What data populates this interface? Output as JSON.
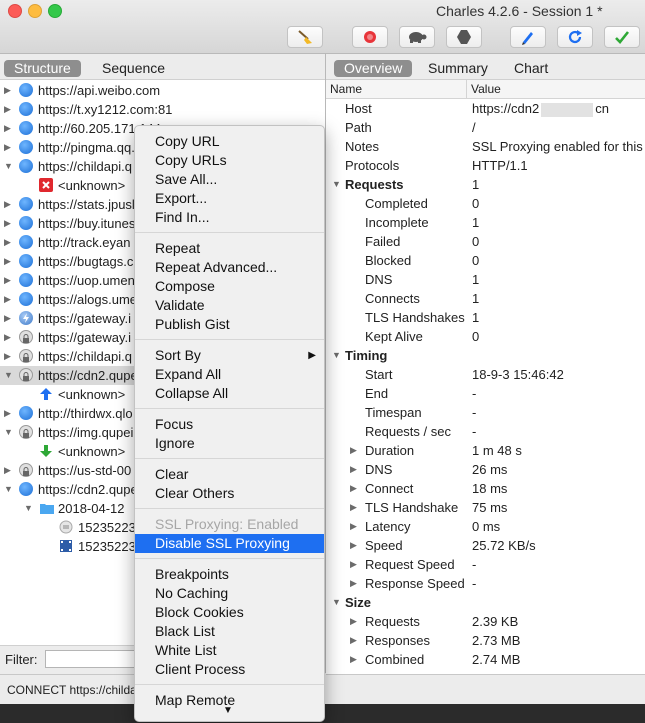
{
  "window": {
    "title": "Charles 4.2.6 - Session 1 *"
  },
  "toolbar": {
    "colors": {
      "record": "#e8343a",
      "accent": "#1e6ff1",
      "check": "#2ea836"
    },
    "buttons": [
      "broom-icon",
      "record-icon",
      "turtle-icon",
      "hexagon-icon",
      "pen-icon",
      "refresh-icon",
      "check-icon"
    ]
  },
  "left_tabs": [
    "Structure",
    "Sequence"
  ],
  "right_tabs": [
    "Overview",
    "Summary",
    "Chart"
  ],
  "tree": [
    {
      "text": "https://api.weibo.com",
      "icon": "globe-icon",
      "expanded": false
    },
    {
      "text": "https://t.xy1212.com:81",
      "icon": "globe-icon",
      "expanded": false
    },
    {
      "text": "http://60.205.171.144",
      "icon": "globe-icon",
      "expanded": false
    },
    {
      "text": "http://pingma.qq.",
      "icon": "globe-icon",
      "expanded": false
    },
    {
      "text": "https://childapi.q",
      "icon": "globe-icon",
      "expanded": true
    },
    {
      "text": "<unknown>",
      "icon": "error-icon",
      "child": true
    },
    {
      "text": "https://stats.jpusl",
      "icon": "globe-icon",
      "expanded": false
    },
    {
      "text": "https://buy.itunes",
      "icon": "globe-icon",
      "expanded": false
    },
    {
      "text": "http://track.eyan",
      "icon": "globe-icon",
      "expanded": false
    },
    {
      "text": "https://bugtags.c",
      "icon": "globe-icon",
      "expanded": false
    },
    {
      "text": "https://uop.umen",
      "icon": "globe-icon",
      "expanded": false
    },
    {
      "text": "https://alogs.ume",
      "icon": "globe-icon",
      "expanded": false
    },
    {
      "text": "https://gateway.i",
      "icon": "flash-icon",
      "expanded": false
    },
    {
      "text": "https://gateway.i",
      "icon": "lock-icon",
      "expanded": false
    },
    {
      "text": "https://childapi.q",
      "icon": "lock-icon",
      "expanded": false
    },
    {
      "text": "https://cdn2.qupe",
      "icon": "lock-icon",
      "expanded": true,
      "selected": true
    },
    {
      "text": "<unknown>",
      "icon": "upload-arrow-icon",
      "child": true
    },
    {
      "text": "http://thirdwx.qlo",
      "icon": "globe-icon",
      "expanded": false
    },
    {
      "text": "https://img.qupei",
      "icon": "lock-icon",
      "expanded": true
    },
    {
      "text": "<unknown>",
      "icon": "download-arrow-icon",
      "child": true
    },
    {
      "text": "https://us-std-00",
      "icon": "lock-icon",
      "expanded": false
    },
    {
      "text": "https://cdn2.qupe",
      "icon": "globe-icon",
      "expanded": true
    },
    {
      "text": "2018-04-12",
      "icon": "folder-icon",
      "child": true,
      "expanded": true
    },
    {
      "text": "15235223",
      "icon": "file-icon",
      "grandchild": true
    },
    {
      "text": "15235223",
      "icon": "film-icon",
      "grandchild": true
    }
  ],
  "filter": {
    "label": "Filter:",
    "value": ""
  },
  "status": {
    "text": "CONNECT https://childap"
  },
  "overview": {
    "columns": {
      "name": "Name",
      "value": "Value"
    },
    "rows": [
      {
        "name": "Host",
        "value": "https://cdn2",
        "value_suffix": "cn",
        "redacted": true,
        "level": 1
      },
      {
        "name": "Path",
        "value": "/",
        "level": 1
      },
      {
        "name": "Notes",
        "value": "SSL Proxying enabled for this h",
        "level": 1
      },
      {
        "name": "Protocols",
        "value": "HTTP/1.1",
        "level": 1
      },
      {
        "name": "Requests",
        "value": "1",
        "level": 0,
        "section": true,
        "expanded": true
      },
      {
        "name": "Completed",
        "value": "0",
        "level": 2
      },
      {
        "name": "Incomplete",
        "value": "1",
        "level": 2
      },
      {
        "name": "Failed",
        "value": "0",
        "level": 2
      },
      {
        "name": "Blocked",
        "value": "0",
        "level": 2
      },
      {
        "name": "DNS",
        "value": "1",
        "level": 2
      },
      {
        "name": "Connects",
        "value": "1",
        "level": 2
      },
      {
        "name": "TLS Handshakes",
        "value": "1",
        "level": 2
      },
      {
        "name": "Kept Alive",
        "value": "0",
        "level": 2
      },
      {
        "name": "Timing",
        "value": "",
        "level": 0,
        "section": true,
        "expanded": true
      },
      {
        "name": "Start",
        "value": "18-9-3 15:46:42",
        "level": 2
      },
      {
        "name": "End",
        "value": "-",
        "level": 2
      },
      {
        "name": "Timespan",
        "value": "-",
        "level": 2
      },
      {
        "name": "Requests / sec",
        "value": "-",
        "level": 2
      },
      {
        "name": "Duration",
        "value": "1 m 48 s",
        "level": 2,
        "collapsed": true
      },
      {
        "name": "DNS",
        "value": "26 ms",
        "level": 2,
        "collapsed": true
      },
      {
        "name": "Connect",
        "value": "18 ms",
        "level": 2,
        "collapsed": true
      },
      {
        "name": "TLS Handshake",
        "value": "75 ms",
        "level": 2,
        "collapsed": true
      },
      {
        "name": "Latency",
        "value": "0 ms",
        "level": 2,
        "collapsed": true
      },
      {
        "name": "Speed",
        "value": "25.72 KB/s",
        "level": 2,
        "collapsed": true
      },
      {
        "name": "Request Speed",
        "value": "-",
        "level": 2,
        "collapsed": true
      },
      {
        "name": "Response Speed",
        "value": "-",
        "level": 2,
        "collapsed": true
      },
      {
        "name": "Size",
        "value": "",
        "level": 0,
        "section": true,
        "expanded": true
      },
      {
        "name": "Requests",
        "value": "2.39 KB",
        "level": 2,
        "collapsed": true
      },
      {
        "name": "Responses",
        "value": "2.73 MB",
        "level": 2,
        "collapsed": true
      },
      {
        "name": "Combined",
        "value": "2.74 MB",
        "level": 2,
        "collapsed": true
      }
    ]
  },
  "context_menu": {
    "groups": [
      [
        "Copy URL",
        "Copy URLs",
        "Save All...",
        "Export...",
        "Find In..."
      ],
      [
        "Repeat",
        "Repeat Advanced...",
        "Compose",
        "Validate",
        "Publish Gist"
      ],
      [
        "Sort By",
        "Expand All",
        "Collapse All"
      ],
      [
        "Focus",
        "Ignore"
      ],
      [
        "Clear",
        "Clear Others"
      ],
      [
        "SSL Proxying: Enabled",
        "Disable SSL Proxying"
      ],
      [
        "Breakpoints",
        "No Caching",
        "Block Cookies",
        "Black List",
        "White List",
        "Client Process"
      ],
      [
        "Map Remote"
      ]
    ],
    "disabled": [
      "SSL Proxying: Enabled"
    ],
    "highlighted": "Disable SSL Proxying",
    "has_submenu": [
      "Sort By"
    ]
  }
}
